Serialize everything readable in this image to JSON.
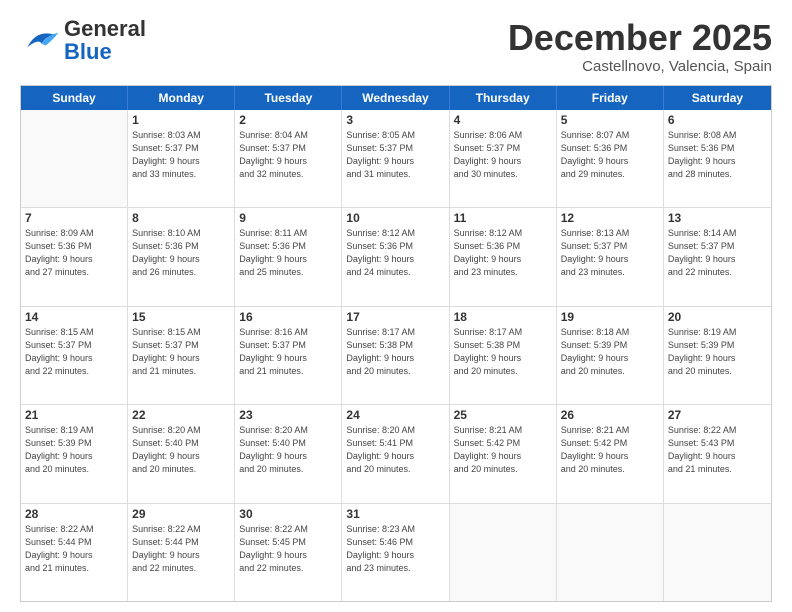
{
  "logo": {
    "general": "General",
    "blue": "Blue"
  },
  "title": {
    "month": "December 2025",
    "location": "Castellnovo, Valencia, Spain"
  },
  "header": {
    "days": [
      "Sunday",
      "Monday",
      "Tuesday",
      "Wednesday",
      "Thursday",
      "Friday",
      "Saturday"
    ]
  },
  "weeks": [
    [
      {
        "day": "",
        "lines": []
      },
      {
        "day": "1",
        "lines": [
          "Sunrise: 8:03 AM",
          "Sunset: 5:37 PM",
          "Daylight: 9 hours",
          "and 33 minutes."
        ]
      },
      {
        "day": "2",
        "lines": [
          "Sunrise: 8:04 AM",
          "Sunset: 5:37 PM",
          "Daylight: 9 hours",
          "and 32 minutes."
        ]
      },
      {
        "day": "3",
        "lines": [
          "Sunrise: 8:05 AM",
          "Sunset: 5:37 PM",
          "Daylight: 9 hours",
          "and 31 minutes."
        ]
      },
      {
        "day": "4",
        "lines": [
          "Sunrise: 8:06 AM",
          "Sunset: 5:37 PM",
          "Daylight: 9 hours",
          "and 30 minutes."
        ]
      },
      {
        "day": "5",
        "lines": [
          "Sunrise: 8:07 AM",
          "Sunset: 5:36 PM",
          "Daylight: 9 hours",
          "and 29 minutes."
        ]
      },
      {
        "day": "6",
        "lines": [
          "Sunrise: 8:08 AM",
          "Sunset: 5:36 PM",
          "Daylight: 9 hours",
          "and 28 minutes."
        ]
      }
    ],
    [
      {
        "day": "7",
        "lines": [
          "Sunrise: 8:09 AM",
          "Sunset: 5:36 PM",
          "Daylight: 9 hours",
          "and 27 minutes."
        ]
      },
      {
        "day": "8",
        "lines": [
          "Sunrise: 8:10 AM",
          "Sunset: 5:36 PM",
          "Daylight: 9 hours",
          "and 26 minutes."
        ]
      },
      {
        "day": "9",
        "lines": [
          "Sunrise: 8:11 AM",
          "Sunset: 5:36 PM",
          "Daylight: 9 hours",
          "and 25 minutes."
        ]
      },
      {
        "day": "10",
        "lines": [
          "Sunrise: 8:12 AM",
          "Sunset: 5:36 PM",
          "Daylight: 9 hours",
          "and 24 minutes."
        ]
      },
      {
        "day": "11",
        "lines": [
          "Sunrise: 8:12 AM",
          "Sunset: 5:36 PM",
          "Daylight: 9 hours",
          "and 23 minutes."
        ]
      },
      {
        "day": "12",
        "lines": [
          "Sunrise: 8:13 AM",
          "Sunset: 5:37 PM",
          "Daylight: 9 hours",
          "and 23 minutes."
        ]
      },
      {
        "day": "13",
        "lines": [
          "Sunrise: 8:14 AM",
          "Sunset: 5:37 PM",
          "Daylight: 9 hours",
          "and 22 minutes."
        ]
      }
    ],
    [
      {
        "day": "14",
        "lines": [
          "Sunrise: 8:15 AM",
          "Sunset: 5:37 PM",
          "Daylight: 9 hours",
          "and 22 minutes."
        ]
      },
      {
        "day": "15",
        "lines": [
          "Sunrise: 8:15 AM",
          "Sunset: 5:37 PM",
          "Daylight: 9 hours",
          "and 21 minutes."
        ]
      },
      {
        "day": "16",
        "lines": [
          "Sunrise: 8:16 AM",
          "Sunset: 5:37 PM",
          "Daylight: 9 hours",
          "and 21 minutes."
        ]
      },
      {
        "day": "17",
        "lines": [
          "Sunrise: 8:17 AM",
          "Sunset: 5:38 PM",
          "Daylight: 9 hours",
          "and 20 minutes."
        ]
      },
      {
        "day": "18",
        "lines": [
          "Sunrise: 8:17 AM",
          "Sunset: 5:38 PM",
          "Daylight: 9 hours",
          "and 20 minutes."
        ]
      },
      {
        "day": "19",
        "lines": [
          "Sunrise: 8:18 AM",
          "Sunset: 5:39 PM",
          "Daylight: 9 hours",
          "and 20 minutes."
        ]
      },
      {
        "day": "20",
        "lines": [
          "Sunrise: 8:19 AM",
          "Sunset: 5:39 PM",
          "Daylight: 9 hours",
          "and 20 minutes."
        ]
      }
    ],
    [
      {
        "day": "21",
        "lines": [
          "Sunrise: 8:19 AM",
          "Sunset: 5:39 PM",
          "Daylight: 9 hours",
          "and 20 minutes."
        ]
      },
      {
        "day": "22",
        "lines": [
          "Sunrise: 8:20 AM",
          "Sunset: 5:40 PM",
          "Daylight: 9 hours",
          "and 20 minutes."
        ]
      },
      {
        "day": "23",
        "lines": [
          "Sunrise: 8:20 AM",
          "Sunset: 5:40 PM",
          "Daylight: 9 hours",
          "and 20 minutes."
        ]
      },
      {
        "day": "24",
        "lines": [
          "Sunrise: 8:20 AM",
          "Sunset: 5:41 PM",
          "Daylight: 9 hours",
          "and 20 minutes."
        ]
      },
      {
        "day": "25",
        "lines": [
          "Sunrise: 8:21 AM",
          "Sunset: 5:42 PM",
          "Daylight: 9 hours",
          "and 20 minutes."
        ]
      },
      {
        "day": "26",
        "lines": [
          "Sunrise: 8:21 AM",
          "Sunset: 5:42 PM",
          "Daylight: 9 hours",
          "and 20 minutes."
        ]
      },
      {
        "day": "27",
        "lines": [
          "Sunrise: 8:22 AM",
          "Sunset: 5:43 PM",
          "Daylight: 9 hours",
          "and 21 minutes."
        ]
      }
    ],
    [
      {
        "day": "28",
        "lines": [
          "Sunrise: 8:22 AM",
          "Sunset: 5:44 PM",
          "Daylight: 9 hours",
          "and 21 minutes."
        ]
      },
      {
        "day": "29",
        "lines": [
          "Sunrise: 8:22 AM",
          "Sunset: 5:44 PM",
          "Daylight: 9 hours",
          "and 22 minutes."
        ]
      },
      {
        "day": "30",
        "lines": [
          "Sunrise: 8:22 AM",
          "Sunset: 5:45 PM",
          "Daylight: 9 hours",
          "and 22 minutes."
        ]
      },
      {
        "day": "31",
        "lines": [
          "Sunrise: 8:23 AM",
          "Sunset: 5:46 PM",
          "Daylight: 9 hours",
          "and 23 minutes."
        ]
      },
      {
        "day": "",
        "lines": []
      },
      {
        "day": "",
        "lines": []
      },
      {
        "day": "",
        "lines": []
      }
    ]
  ]
}
